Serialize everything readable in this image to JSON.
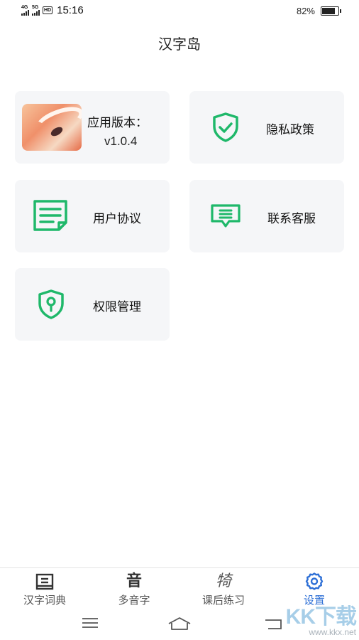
{
  "status_bar": {
    "network_1": "4G",
    "network_2": "5G",
    "hd_badge": "HD",
    "time": "15:16",
    "battery_percent": "82%",
    "battery_level": 0.82
  },
  "header": {
    "title": "汉字岛"
  },
  "cards": {
    "version": {
      "label": "应用版本：",
      "value": "v1.0.4"
    },
    "privacy": {
      "label": "隐私政策",
      "icon": "shield-check-icon"
    },
    "agreement": {
      "label": "用户协议",
      "icon": "document-icon"
    },
    "service": {
      "label": "联系客服",
      "icon": "chat-message-icon"
    },
    "permission": {
      "label": "权限管理",
      "icon": "shield-key-icon"
    }
  },
  "bottom_nav": {
    "items": [
      {
        "label": "汉字词典",
        "icon": "dictionary-icon",
        "glyph": "",
        "active": false
      },
      {
        "label": "多音字",
        "icon": "yin-glyph-icon",
        "glyph": "音",
        "active": false
      },
      {
        "label": "课后练习",
        "icon": "practice-glyph-icon",
        "glyph": "犄",
        "active": false
      },
      {
        "label": "设置",
        "icon": "gear-icon",
        "glyph": "",
        "active": true
      }
    ]
  },
  "watermark": {
    "logo": "KK下载",
    "url": "www.kkx.net"
  },
  "colors": {
    "accent_green": "#1fb86a",
    "active_blue": "#2d6fd6",
    "card_bg": "#f5f6f8"
  }
}
